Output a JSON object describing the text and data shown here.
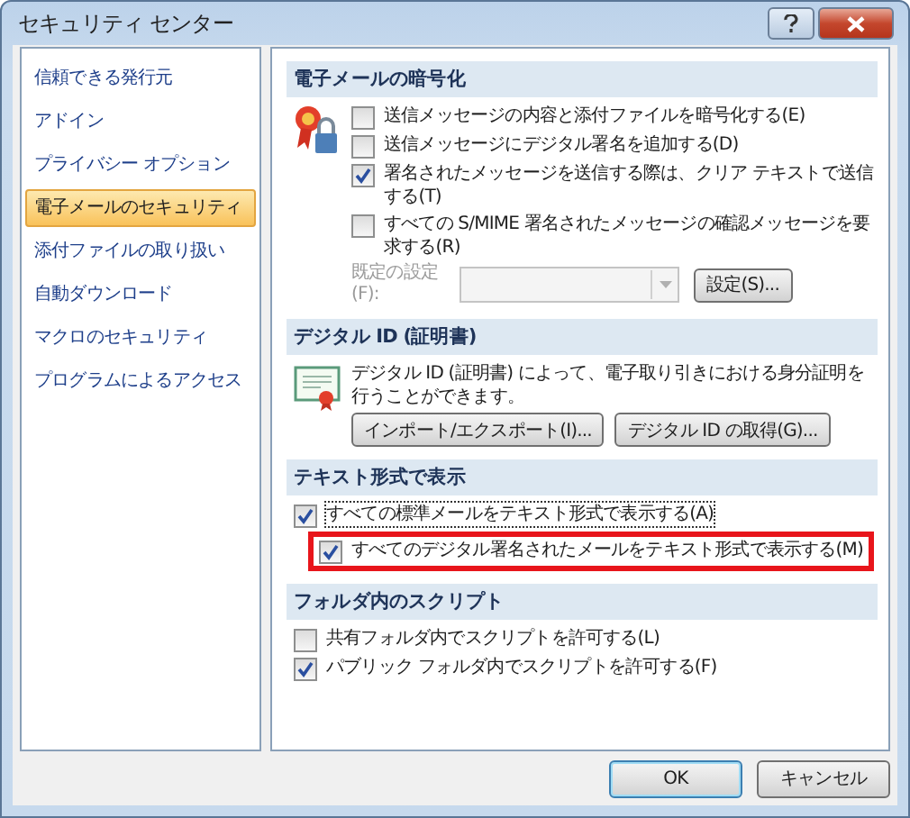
{
  "window": {
    "title": "セキュリティ センター"
  },
  "sidebar": {
    "items": [
      {
        "label": "信頼できる発行元",
        "selected": false
      },
      {
        "label": "アドイン",
        "selected": false
      },
      {
        "label": "プライバシー オプション",
        "selected": false
      },
      {
        "label": "電子メールのセキュリティ",
        "selected": true
      },
      {
        "label": "添付ファイルの取り扱い",
        "selected": false
      },
      {
        "label": "自動ダウンロード",
        "selected": false
      },
      {
        "label": "マクロのセキュリティ",
        "selected": false
      },
      {
        "label": "プログラムによるアクセス",
        "selected": false
      }
    ]
  },
  "sections": [
    {
      "title": "電子メールの暗号化",
      "rows": [
        {
          "kind": "checkbox",
          "label": "送信メッセージの内容と添付ファイルを暗号化する(E)",
          "checked": false
        },
        {
          "kind": "checkbox",
          "label": "送信メッセージにデジタル署名を追加する(D)",
          "checked": false
        },
        {
          "kind": "checkbox",
          "label": "署名されたメッセージを送信する際は、クリア テキストで送信する(T)",
          "checked": true
        },
        {
          "kind": "checkbox",
          "label": "すべての S/MIME 署名されたメッセージの確認メッセージを要求する(R)",
          "checked": false
        },
        {
          "kind": "setting",
          "label": "既定の設定(F):",
          "disabled": true,
          "button": "設定(S)..."
        }
      ]
    },
    {
      "title": "デジタル ID (証明書)",
      "rows": [
        {
          "kind": "text",
          "text": "デジタル ID (証明書) によって、電子取り引きにおける身分証明を行うことができます。"
        },
        {
          "kind": "buttons",
          "buttons": [
            "インポート/エクスポート(I)...",
            "デジタル ID の取得(G)..."
          ]
        }
      ]
    },
    {
      "title": "テキスト形式で表示",
      "rows": [
        {
          "kind": "checkbox",
          "label": "すべての標準メールをテキスト形式で表示する(A)",
          "checked": true,
          "focused": true,
          "children": [
            {
              "kind": "checkbox",
              "label": "すべてのデジタル署名されたメールをテキスト形式で表示する(M)",
              "checked": true,
              "highlighted": true
            }
          ]
        }
      ]
    },
    {
      "title": "フォルダ内のスクリプト",
      "rows": [
        {
          "kind": "checkbox",
          "label": "共有フォルダ内でスクリプトを許可する(L)",
          "checked": false
        },
        {
          "kind": "checkbox",
          "label": "パブリック フォルダ内でスクリプトを許可する(F)",
          "checked": true
        }
      ]
    }
  ],
  "buttons": [
    "OK",
    "キャンセル"
  ]
}
